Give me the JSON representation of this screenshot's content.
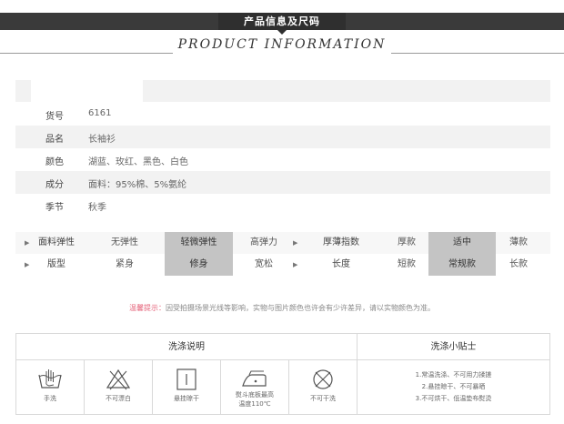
{
  "header": {
    "title": "产品信息及尺码",
    "subtitle": "PRODUCT INFORMATION"
  },
  "info": [
    {
      "label": "货号",
      "value": "6161"
    },
    {
      "label": "品名",
      "value": "长袖衫"
    },
    {
      "label": "颜色",
      "value": "湖蓝、玫红、黑色、白色"
    },
    {
      "label": "成分",
      "value": "面料：95%棉、5%氨纶"
    },
    {
      "label": "季节",
      "value": "秋季"
    }
  ],
  "properties": {
    "elasticity": {
      "label": "面料弹性",
      "options": [
        "无弹性",
        "轻微弹性",
        "高弹力"
      ],
      "selected": "轻微弹性"
    },
    "thickness": {
      "label": "厚薄指数",
      "options": [
        "厚款",
        "适中",
        "薄款"
      ],
      "selected": "适中"
    },
    "fit": {
      "label": "版型",
      "options": [
        "紧身",
        "修身",
        "宽松"
      ],
      "selected": "修身"
    },
    "length": {
      "label": "长度",
      "options": [
        "短款",
        "常规款",
        "长款"
      ],
      "selected": "常规款"
    }
  },
  "notice": {
    "prefix": "温馨提示：",
    "text": "因受拍摄场景光线等影响，实物与图片颜色也许会有少许差异，请以实物颜色为准。"
  },
  "care": {
    "instructions_title": "洗涤说明",
    "tips_title": "洗涤小贴士",
    "icons": [
      {
        "icon": "hand-wash-icon",
        "label": "手洗"
      },
      {
        "icon": "no-bleach-icon",
        "label": "不可漂白"
      },
      {
        "icon": "hang-dry-icon",
        "label": "悬挂晾干"
      },
      {
        "icon": "iron-icon",
        "label": "熨斗底板最高",
        "label2": "温度110℃"
      },
      {
        "icon": "no-dry-clean-icon",
        "label": "不可干洗"
      }
    ],
    "tips": [
      "1.常温洗涤、不可用力揉搓",
      "2.悬挂晾干、不可暴晒",
      "3.不可烘干、低温垫布熨烫"
    ]
  },
  "colors": {
    "banner": "#3a3a3a",
    "highlight": "#c4c4c4",
    "notice_accent": "#e5637a"
  }
}
